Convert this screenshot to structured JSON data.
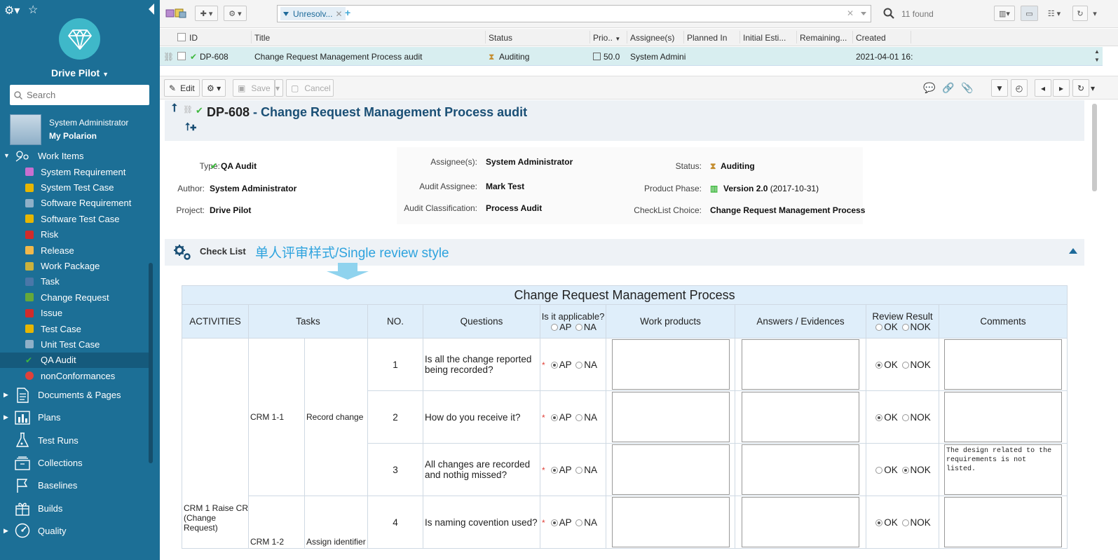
{
  "sidebar": {
    "project_name": "Drive Pilot",
    "search_placeholder": "Search",
    "user_name": "System Administrator",
    "user_link": "My Polarion",
    "work_items_label": "Work Items",
    "work_item_types": [
      {
        "label": "System Requirement",
        "color": "#c86fd0"
      },
      {
        "label": "System Test Case",
        "color": "#e6b600"
      },
      {
        "label": "Software Requirement",
        "color": "#8fb0c8"
      },
      {
        "label": "Software Test Case",
        "color": "#e6b600"
      },
      {
        "label": "Risk",
        "color": "#d12b2b"
      },
      {
        "label": "Release",
        "color": "#f0b84b"
      },
      {
        "label": "Work Package",
        "color": "#c9b23d"
      },
      {
        "label": "Task",
        "color": "#4a77a8"
      },
      {
        "label": "Change Request",
        "color": "#65a83a"
      },
      {
        "label": "Issue",
        "color": "#d12b2b"
      },
      {
        "label": "Test Case",
        "color": "#e6b600"
      },
      {
        "label": "Unit Test Case",
        "color": "#8fb0c8"
      },
      {
        "label": "QA Audit",
        "color": "#3fb83f"
      },
      {
        "label": "nonConformances",
        "color": "#e0413a"
      }
    ],
    "sections": [
      {
        "label": "Documents & Pages",
        "icon": "document-icon",
        "expandable": true
      },
      {
        "label": "Plans",
        "icon": "plans-icon",
        "expandable": true
      },
      {
        "label": "Test Runs",
        "icon": "flask-icon",
        "expandable": false
      },
      {
        "label": "Collections",
        "icon": "collection-icon",
        "expandable": false
      },
      {
        "label": "Baselines",
        "icon": "flag-icon",
        "expandable": false
      },
      {
        "label": "Builds",
        "icon": "gift-icon",
        "expandable": false
      },
      {
        "label": "Quality",
        "icon": "gauge-icon",
        "expandable": true
      }
    ]
  },
  "toolbar": {
    "query_chip": "Unresolv...",
    "found_count": "11 found"
  },
  "grid": {
    "columns": [
      "ID",
      "Title",
      "Status",
      "Prio..",
      "Assignee(s)",
      "Planned In",
      "Initial Esti...",
      "Remaining...",
      "Created"
    ],
    "row": {
      "id": "DP-608",
      "title": "Change Request Management Process audit",
      "status": "Auditing",
      "priority": "50.0",
      "assignee": "System Admini",
      "created": "2021-04-01 16:"
    }
  },
  "editbar": {
    "edit": "Edit",
    "save": "Save",
    "cancel": "Cancel"
  },
  "workitem": {
    "id": "DP-608",
    "separator": " - ",
    "title": "Change Request Management Process audit",
    "fields": {
      "type_label": "Type:",
      "type_value": "QA Audit",
      "author_label": "Author:",
      "author_value": "System Administrator",
      "project_label": "Project:",
      "project_value": "Drive Pilot",
      "assignees_label": "Assignee(s):",
      "assignees_value": "System Administrator",
      "audit_assignee_label": "Audit Assignee:",
      "audit_assignee_value": "Mark Test",
      "audit_class_label": "Audit Classification:",
      "audit_class_value": "Process Audit",
      "status_label": "Status:",
      "status_value": "Auditing",
      "phase_label": "Product Phase:",
      "phase_value": "Version 2.0",
      "phase_date": "(2017-10-31)",
      "checklist_label": "CheckList Choice:",
      "checklist_value": "Change Request Management Process"
    }
  },
  "checklist": {
    "section_title": "Check List",
    "style_note": "单人评审样式/Single review style",
    "table_title": "Change Request Management Process",
    "headers": {
      "activities": "ACTIVITIES",
      "tasks": "Tasks",
      "no": "NO.",
      "questions": "Questions",
      "applicable": "Is it applicable?",
      "work_products": "Work products",
      "answers": "Answers / Evidences",
      "review_result": "Review Result",
      "comments": "Comments"
    },
    "opt_ap": "AP",
    "opt_na": "NA",
    "opt_ok": "OK",
    "opt_nok": "NOK",
    "activity": "CRM 1 Raise CR (Change Request)",
    "rows": [
      {
        "task_id": "CRM 1-1",
        "task": "Record change",
        "no": "1",
        "question": "Is all the change reported being recorded?",
        "applicable": "AP",
        "result": "OK",
        "comment": ""
      },
      {
        "task_id": "",
        "task": "",
        "no": "2",
        "question": "How do you receive it?",
        "applicable": "AP",
        "result": "OK",
        "comment": ""
      },
      {
        "task_id": "",
        "task": "",
        "no": "3",
        "question": "All changes are recorded and nothig missed?",
        "applicable": "AP",
        "result": "NOK",
        "comment": "The design related to the requirements is not listed."
      },
      {
        "task_id": "CRM 1-2",
        "task": "Assign identifier",
        "no": "4",
        "question": "Is naming covention used?",
        "applicable": "AP",
        "result": "OK",
        "comment": ""
      }
    ]
  },
  "colors": {
    "sidebar_bg": "#1c6f96",
    "accent": "#2ea3de",
    "title_text": "#1a4f75",
    "row_selected": "#d8eef0"
  }
}
